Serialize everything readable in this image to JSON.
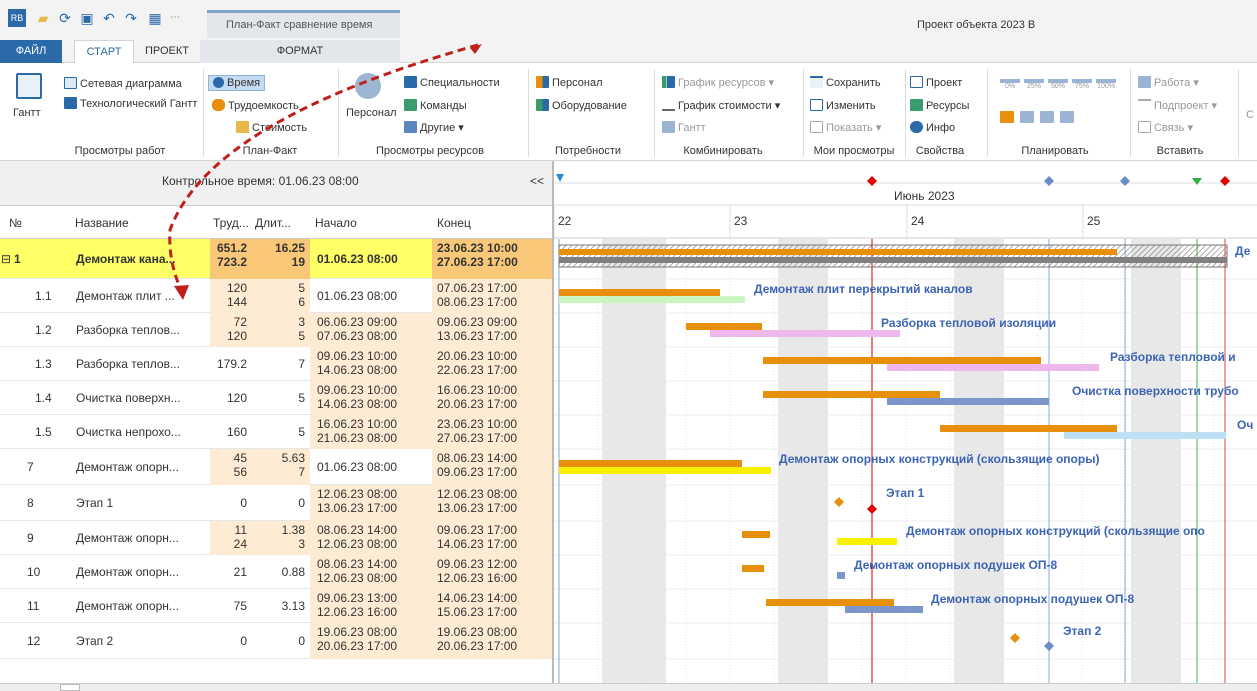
{
  "app": {
    "context_label": "План-Факт сравнение время",
    "title": "Проект объекта 2023 В"
  },
  "tabs": {
    "file": "ФАЙЛ",
    "start": "СТАРТ",
    "project": "ПРОЕКТ",
    "format": "ФОРМАТ"
  },
  "ribbon": {
    "gantt": "Гантт",
    "network": "Сетевая диаграмма",
    "tech_gantt": "Технологический Гантт",
    "views_group": "Просмотры работ",
    "time": "Время",
    "labor": "Трудоемкость",
    "cost": "Стоимость",
    "planfact_group": "План-Факт",
    "personnel_big": "Персонал",
    "specialties": "Специальности",
    "teams": "Команды",
    "others": "Другие ▾",
    "resources_group": "Просмотры ресурсов",
    "need_personnel": "Персонал",
    "equipment": "Оборудование",
    "needs_group": "Потребности",
    "res_chart": "График ресурсов ▾",
    "cost_chart": "График стоимости ▾",
    "gantt_small": "Гантт",
    "combine_group": "Комбинировать",
    "save": "Сохранить",
    "edit": "Изменить",
    "show": "Показать ▾",
    "myviews_group": "Мои просмотры",
    "project_prop": "Проект",
    "resources_prop": "Ресурсы",
    "info": "Инфо",
    "props_group": "Свойства",
    "pct": [
      "0%",
      "25%",
      "50%",
      "75%",
      "100%"
    ],
    "plan_group": "Планировать",
    "work": "Работа ▾",
    "subproject": "Подпроект ▾",
    "link": "Связь ▾",
    "insert_group": "Вставить",
    "edge_c": "С"
  },
  "control_time": "Контрольное время: 01.06.23 08:00",
  "collapse": "<<",
  "columns": {
    "num": "№",
    "name": "Название",
    "labor": "Труд...",
    "dur": "Длит...",
    "start": "Начало",
    "end": "Конец"
  },
  "rows": [
    {
      "num": "1",
      "name": "Демонтаж кана...",
      "labor": [
        "651.2",
        "723.2"
      ],
      "dur": [
        "16.25",
        "19"
      ],
      "start": [
        "01.06.23 08:00"
      ],
      "end": [
        "23.06.23 10:00",
        "27.06.23 17:00"
      ],
      "summary": true
    },
    {
      "num": "1.1",
      "name": "Демонтаж плит ...",
      "labor": [
        "120",
        "144"
      ],
      "dur": [
        "5",
        "6"
      ],
      "start": [
        "01.06.23 08:00"
      ],
      "end": [
        "07.06.23 17:00",
        "08.06.23 17:00"
      ]
    },
    {
      "num": "1.2",
      "name": "Разборка теплов...",
      "labor": [
        "72",
        "120"
      ],
      "dur": [
        "3",
        "5"
      ],
      "start": [
        "06.06.23 09:00",
        "07.06.23 08:00"
      ],
      "end": [
        "09.06.23 09:00",
        "13.06.23 17:00"
      ]
    },
    {
      "num": "1.3",
      "name": "Разборка теплов...",
      "labor": [
        "179.2"
      ],
      "dur": [
        "7"
      ],
      "start": [
        "09.06.23 10:00",
        "14.06.23 08:00"
      ],
      "end": [
        "20.06.23 10:00",
        "22.06.23 17:00"
      ]
    },
    {
      "num": "1.4",
      "name": "Очистка поверхн...",
      "labor": [
        "120"
      ],
      "dur": [
        "5"
      ],
      "start": [
        "09.06.23 10:00",
        "14.06.23 08:00"
      ],
      "end": [
        "16.06.23 10:00",
        "20.06.23 17:00"
      ]
    },
    {
      "num": "1.5",
      "name": "Очистка непрохо...",
      "labor": [
        "160"
      ],
      "dur": [
        "5"
      ],
      "start": [
        "16.06.23 10:00",
        "21.06.23 08:00"
      ],
      "end": [
        "23.06.23 10:00",
        "27.06.23 17:00"
      ]
    },
    {
      "num": "7",
      "name": "Демонтаж опорн...",
      "labor": [
        "45",
        "56"
      ],
      "dur": [
        "5.63",
        "7"
      ],
      "start": [
        "01.06.23 08:00"
      ],
      "end": [
        "08.06.23 14:00",
        "09.06.23 17:00"
      ]
    },
    {
      "num": "8",
      "name": "Этап 1",
      "labor": [
        "0"
      ],
      "dur": [
        "0"
      ],
      "start": [
        "12.06.23 08:00",
        "13.06.23 17:00"
      ],
      "end": [
        "12.06.23 08:00",
        "13.06.23 17:00"
      ]
    },
    {
      "num": "9",
      "name": "Демонтаж опорн...",
      "labor": [
        "11",
        "24"
      ],
      "dur": [
        "1.38",
        "3"
      ],
      "start": [
        "08.06.23 14:00",
        "12.06.23 08:00"
      ],
      "end": [
        "09.06.23 17:00",
        "14.06.23 17:00"
      ]
    },
    {
      "num": "10",
      "name": "Демонтаж опорн...",
      "labor": [
        "21"
      ],
      "dur": [
        "0.88"
      ],
      "start": [
        "08.06.23 14:00",
        "12.06.23 08:00"
      ],
      "end": [
        "09.06.23 12:00",
        "12.06.23 16:00"
      ]
    },
    {
      "num": "11",
      "name": "Демонтаж опорн...",
      "labor": [
        "75"
      ],
      "dur": [
        "3.13"
      ],
      "start": [
        "09.06.23 13:00",
        "12.06.23 16:00"
      ],
      "end": [
        "14.06.23 14:00",
        "15.06.23 17:00"
      ]
    },
    {
      "num": "12",
      "name": "Этап 2",
      "labor": [
        "0"
      ],
      "dur": [
        "0"
      ],
      "start": [
        "19.06.23 08:00",
        "20.06.23 17:00"
      ],
      "end": [
        "19.06.23 08:00",
        "20.06.23 17:00"
      ]
    }
  ],
  "gantt": {
    "month": "Июнь 2023",
    "days": [
      "22",
      "23",
      "24",
      "25"
    ],
    "labels": {
      "summary": "Де",
      "r1": "Демонтаж  плит перекрытий каналов",
      "r2": "Разборка тепловой изоляции",
      "r3": "Разборка тепловой и",
      "r4": "Очистка поверхности трубо",
      "r5": "Оч",
      "r7": "Демонтаж опорных конструкций (скользящие опоры)",
      "r8": "Этап 1",
      "r9": "Демонтаж опорных конструкций (скользящие опо",
      "r10": "Демонтаж опорных подушек ОП-8",
      "r11": "Демонтаж опорных подушек ОП-8",
      "r12": "Этап 2"
    },
    "colors": {
      "plan": "#e8900c",
      "summary": "#808080",
      "fact_green": "#c8f5c0",
      "fact_pink": "#eeb8ee",
      "fact_blue": "#7b96c8",
      "fact_lightblue": "#bde0f5",
      "fact_yellow": "#f8f000",
      "control_line": "#d00000",
      "label": "#3c64b4"
    }
  },
  "icons": [
    "app-icon",
    "open-folder-icon",
    "refresh-icon",
    "save-icon",
    "undo-icon",
    "redo-icon",
    "table-icon"
  ]
}
